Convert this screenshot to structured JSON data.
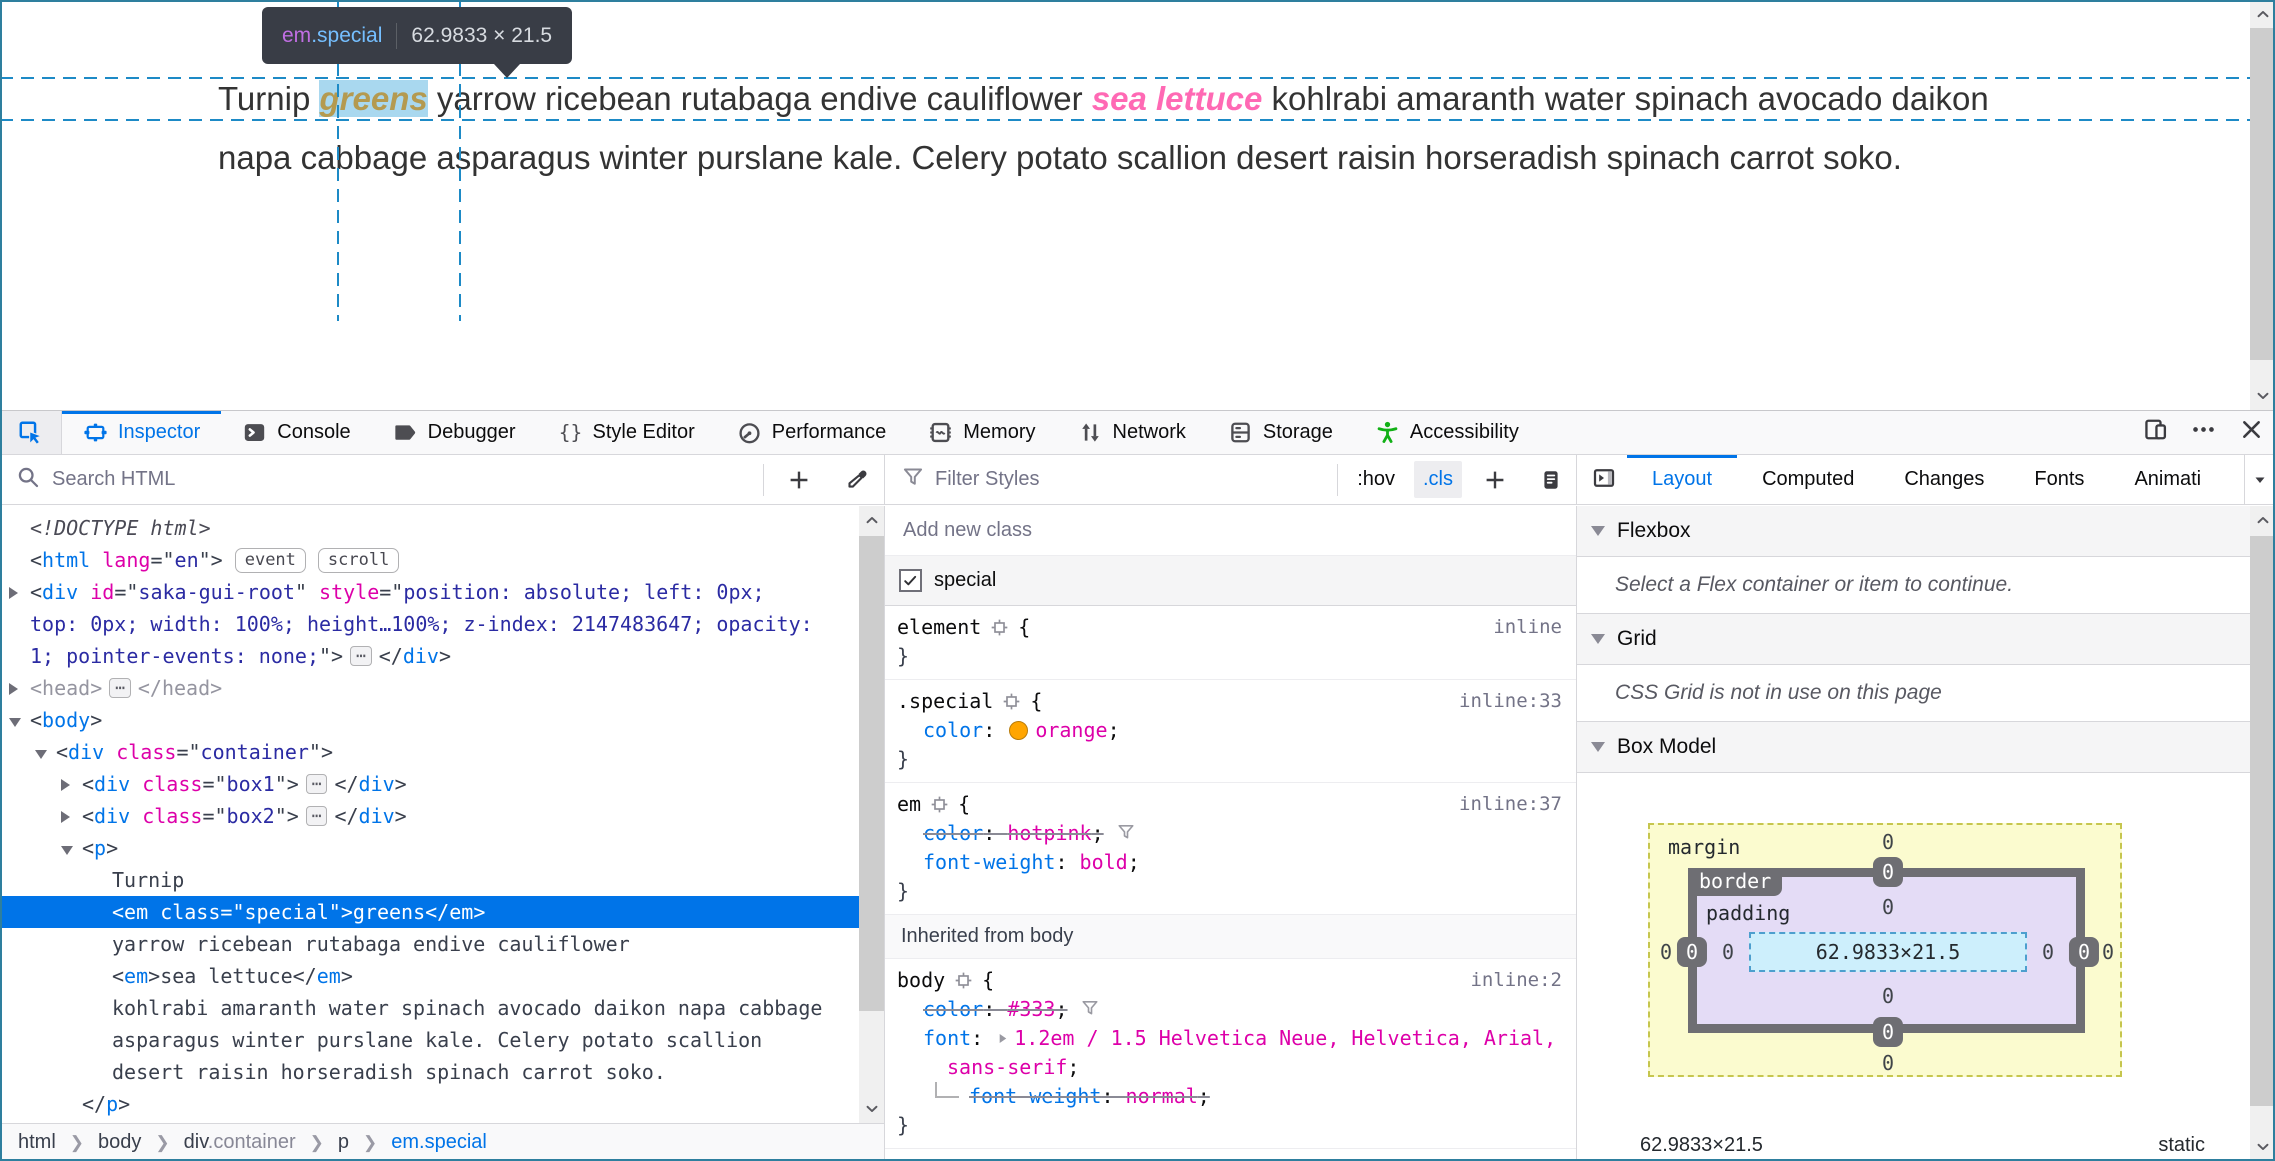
{
  "page": {
    "tooltip": {
      "tag": "em",
      "class": ".special",
      "dims": "62.9833 × 21.5"
    },
    "text_segments": [
      {
        "text": "Turnip ",
        "style": "plain"
      },
      {
        "text": "greens",
        "style": "em-special"
      },
      {
        "text": " yarrow ricebean rutabaga endive cauliflower ",
        "style": "plain"
      },
      {
        "text": "sea lettuce",
        "style": "em"
      },
      {
        "text": " kohlrabi amaranth water spinach avocado daikon napa cabbage asparagus winter purslane kale. Celery potato scallion desert raisin horseradish spinach carrot soko.",
        "style": "plain"
      }
    ]
  },
  "colors": {
    "accent": "#0074e8",
    "attr": "#dd00a9",
    "accessibility_green": "#12b016",
    "guide_blue": "#1d8ac6",
    "selection": "#0074e8"
  },
  "toolbar": {
    "picker_icon": "node-picker-icon",
    "tabs": [
      {
        "id": "inspector",
        "label": "Inspector",
        "icon": "inspector-icon",
        "active": true
      },
      {
        "id": "console",
        "label": "Console",
        "icon": "console-icon"
      },
      {
        "id": "debugger",
        "label": "Debugger",
        "icon": "debugger-icon"
      },
      {
        "id": "style-editor",
        "label": "Style Editor",
        "icon": "style-editor-icon"
      },
      {
        "id": "performance",
        "label": "Performance",
        "icon": "performance-icon"
      },
      {
        "id": "memory",
        "label": "Memory",
        "icon": "memory-icon"
      },
      {
        "id": "network",
        "label": "Network",
        "icon": "network-icon"
      },
      {
        "id": "storage",
        "label": "Storage",
        "icon": "storage-icon"
      },
      {
        "id": "accessibility",
        "label": "Accessibility",
        "icon": "accessibility-icon"
      }
    ],
    "window_buttons": [
      {
        "id": "responsive-design-mode",
        "icon": "responsive-icon"
      },
      {
        "id": "devtools-menu",
        "icon": "meatball-menu-icon"
      },
      {
        "id": "close-devtools",
        "icon": "close-icon"
      }
    ]
  },
  "markup_panel": {
    "search_placeholder": "Search HTML",
    "tree": [
      {
        "i": 0,
        "parts": [
          [
            "doctype",
            "<!DOCTYPE html>"
          ]
        ]
      },
      {
        "i": 0,
        "parts": [
          [
            "pt",
            "<"
          ],
          [
            "tg",
            "html"
          ],
          [
            "pt",
            " "
          ],
          [
            "at",
            "lang"
          ],
          [
            "pt",
            "=\""
          ],
          [
            "vl",
            "en"
          ],
          [
            "pt",
            "\">"
          ],
          [
            "wsb",
            "event"
          ],
          [
            "wsb",
            "scroll"
          ]
        ]
      },
      {
        "i": 0,
        "arrow": "r",
        "parts": [
          [
            "pt",
            "<"
          ],
          [
            "tg",
            "div"
          ],
          [
            "pt",
            " "
          ],
          [
            "at",
            "id"
          ],
          [
            "pt",
            "=\""
          ],
          [
            "vl",
            "saka-gui-root"
          ],
          [
            "pt",
            "\" "
          ],
          [
            "at",
            "style"
          ],
          [
            "pt",
            "=\""
          ],
          [
            "vl",
            "position: absolute; left: 0px;"
          ]
        ]
      },
      {
        "i": 0,
        "cont": true,
        "parts": [
          [
            "vl",
            "top: 0px; width: 100%; height…100%; z-index: 2147483647; opacity:"
          ]
        ]
      },
      {
        "i": 0,
        "cont": true,
        "parts": [
          [
            "vl",
            "1; pointer-events: none;"
          ],
          [
            "pt",
            "\">"
          ],
          [
            "dots",
            "⋯"
          ],
          [
            "pt",
            "</"
          ],
          [
            "tg",
            "div"
          ],
          [
            "pt",
            ">"
          ]
        ]
      },
      {
        "i": 0,
        "arrow": "r",
        "parts": [
          [
            "dm",
            "<head>"
          ],
          [
            "dots",
            "⋯"
          ],
          [
            "dm",
            "</head>"
          ]
        ]
      },
      {
        "i": 0,
        "arrow": "d",
        "parts": [
          [
            "pt",
            "<"
          ],
          [
            "tg",
            "body"
          ],
          [
            "pt",
            ">"
          ]
        ]
      },
      {
        "i": 1,
        "arrow": "d",
        "parts": [
          [
            "pt",
            "<"
          ],
          [
            "tg",
            "div"
          ],
          [
            "pt",
            " "
          ],
          [
            "at",
            "class"
          ],
          [
            "pt",
            "=\""
          ],
          [
            "vl",
            "container"
          ],
          [
            "pt",
            "\">"
          ]
        ]
      },
      {
        "i": 2,
        "arrow": "r",
        "parts": [
          [
            "pt",
            "<"
          ],
          [
            "tg",
            "div"
          ],
          [
            "pt",
            " "
          ],
          [
            "at",
            "class"
          ],
          [
            "pt",
            "=\""
          ],
          [
            "vl",
            "box1"
          ],
          [
            "pt",
            "\">"
          ],
          [
            "dots",
            "⋯"
          ],
          [
            "pt",
            "</"
          ],
          [
            "tg",
            "div"
          ],
          [
            "pt",
            ">"
          ]
        ]
      },
      {
        "i": 2,
        "arrow": "r",
        "parts": [
          [
            "pt",
            "<"
          ],
          [
            "tg",
            "div"
          ],
          [
            "pt",
            " "
          ],
          [
            "at",
            "class"
          ],
          [
            "pt",
            "=\""
          ],
          [
            "vl",
            "box2"
          ],
          [
            "pt",
            "\">"
          ],
          [
            "dots",
            "⋯"
          ],
          [
            "pt",
            "</"
          ],
          [
            "tg",
            "div"
          ],
          [
            "pt",
            ">"
          ]
        ]
      },
      {
        "i": 2,
        "arrow": "d",
        "parts": [
          [
            "pt",
            "<"
          ],
          [
            "tg",
            "p"
          ],
          [
            "pt",
            ">"
          ]
        ]
      },
      {
        "i": 3,
        "parts": [
          [
            "tx",
            "Turnip"
          ]
        ]
      },
      {
        "i": 3,
        "selected": true,
        "parts": [
          [
            "pt",
            "<"
          ],
          [
            "tg",
            "em"
          ],
          [
            "pt",
            " "
          ],
          [
            "at",
            "class"
          ],
          [
            "pt",
            "=\""
          ],
          [
            "vl",
            "special"
          ],
          [
            "pt",
            "\">"
          ],
          [
            "tx",
            "greens"
          ],
          [
            "pt",
            "</"
          ],
          [
            "tg",
            "em"
          ],
          [
            "pt",
            ">"
          ]
        ]
      },
      {
        "i": 3,
        "parts": [
          [
            "tx",
            "yarrow ricebean rutabaga endive cauliflower"
          ]
        ]
      },
      {
        "i": 3,
        "parts": [
          [
            "pt",
            "<"
          ],
          [
            "tg",
            "em"
          ],
          [
            "pt",
            ">"
          ],
          [
            "tx",
            "sea lettuce"
          ],
          [
            "pt",
            "</"
          ],
          [
            "tg",
            "em"
          ],
          [
            "pt",
            ">"
          ]
        ]
      },
      {
        "i": 3,
        "parts": [
          [
            "tx",
            "kohlrabi amaranth water spinach avocado daikon napa cabbage"
          ]
        ]
      },
      {
        "i": 3,
        "cont": true,
        "parts": [
          [
            "tx",
            "asparagus winter purslane kale. Celery potato scallion"
          ]
        ]
      },
      {
        "i": 3,
        "cont": true,
        "parts": [
          [
            "tx",
            "desert raisin horseradish spinach carrot soko."
          ]
        ]
      },
      {
        "i": 2,
        "parts": [
          [
            "pt",
            "</"
          ],
          [
            "tg",
            "p"
          ],
          [
            "pt",
            ">"
          ]
        ]
      }
    ],
    "breadcrumb": [
      {
        "name": "html"
      },
      {
        "name": "body"
      },
      {
        "name": "div",
        "cls": ".container"
      },
      {
        "name": "p"
      },
      {
        "name": "em.special",
        "active": true
      }
    ]
  },
  "rules_panel": {
    "filter_placeholder": "Filter Styles",
    "pseudo_button": ":hov",
    "class_button": ".cls",
    "add_class_placeholder": "Add new class",
    "class_toggle": {
      "checked": true,
      "label": "special"
    },
    "rules": [
      {
        "selector": "element",
        "location": "inline",
        "decls": []
      },
      {
        "selector": ".special",
        "location": "inline:33",
        "decls": [
          {
            "name": "color",
            "value": "orange",
            "swatch": "#ffa500"
          }
        ]
      },
      {
        "selector": "em",
        "location": "inline:37",
        "decls": [
          {
            "name": "color",
            "value": "hotpink",
            "overridden": true,
            "filter_icon": true
          },
          {
            "name": "font-weight",
            "value": "bold"
          }
        ]
      }
    ],
    "inherited_header": "Inherited from body",
    "inherited_rules": [
      {
        "selector": "body",
        "location": "inline:2",
        "decls": [
          {
            "name": "color",
            "value": "#333",
            "overridden": true,
            "filter_icon": true
          },
          {
            "name": "font",
            "value": "1.2em / 1.5 Helvetica Neue, Helvetica, Arial, sans-serif",
            "expandable": true,
            "sub_decls": [
              {
                "name": "font-weight",
                "value": "normal",
                "overridden": true
              }
            ]
          }
        ]
      }
    ]
  },
  "layout_panel": {
    "tabs": [
      {
        "label": "Layout",
        "active": true
      },
      {
        "label": "Computed"
      },
      {
        "label": "Changes"
      },
      {
        "label": "Fonts"
      },
      {
        "label": "Animati"
      }
    ],
    "sections": [
      {
        "title": "Flexbox",
        "message": "Select a Flex container or item to continue."
      },
      {
        "title": "Grid",
        "message": "CSS Grid is not in use on this page"
      },
      {
        "title": "Box Model"
      }
    ],
    "box_model": {
      "margin_label": "margin",
      "border_label": "border",
      "padding_label": "padding",
      "content": "62.9833×21.5",
      "margin": {
        "top": "0",
        "right": "0",
        "bottom": "0",
        "left": "0"
      },
      "border": {
        "top": "0",
        "right": "0",
        "bottom": "0",
        "left": "0"
      },
      "padding": {
        "top": "0",
        "right": "0",
        "bottom": "0",
        "left": "0"
      }
    },
    "footer": {
      "dims": "62.9833×21.5",
      "position": "static"
    }
  }
}
